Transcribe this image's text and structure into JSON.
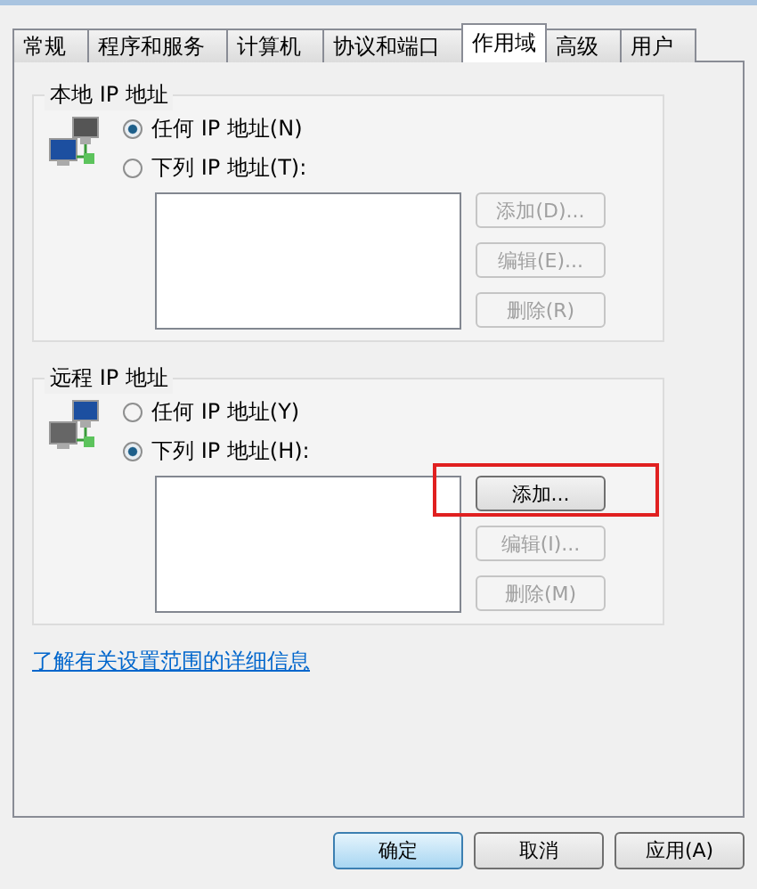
{
  "tabs": [
    {
      "label": "常规",
      "selected": false
    },
    {
      "label": "程序和服务",
      "selected": false
    },
    {
      "label": "计算机",
      "selected": false
    },
    {
      "label": "协议和端口",
      "selected": false
    },
    {
      "label": "作用域",
      "selected": true
    },
    {
      "label": "高级",
      "selected": false
    },
    {
      "label": "用户",
      "selected": false
    }
  ],
  "groups": [
    {
      "title": "本地 IP 地址",
      "radios": [
        {
          "label": "任何 IP 地址(N)",
          "selected": true
        },
        {
          "label": "下列 IP 地址(T):",
          "selected": false
        }
      ],
      "buttons": [
        {
          "label": "添加(D)...",
          "disabled": true,
          "highlighted": false
        },
        {
          "label": "编辑(E)...",
          "disabled": true,
          "highlighted": false
        },
        {
          "label": "删除(R)",
          "disabled": true,
          "highlighted": false
        }
      ]
    },
    {
      "title": "远程 IP 地址",
      "radios": [
        {
          "label": "任何 IP 地址(Y)",
          "selected": false
        },
        {
          "label": "下列 IP 地址(H):",
          "selected": true
        }
      ],
      "buttons": [
        {
          "label": "添加...",
          "disabled": false,
          "highlighted": true
        },
        {
          "label": "编辑(I)...",
          "disabled": true,
          "highlighted": false
        },
        {
          "label": "删除(M)",
          "disabled": true,
          "highlighted": false
        }
      ]
    }
  ],
  "link": "了解有关设置范围的详细信息",
  "footer_buttons": [
    {
      "label": "确定",
      "default": true
    },
    {
      "label": "取消",
      "default": false
    },
    {
      "label": "应用(A)",
      "default": false
    }
  ]
}
